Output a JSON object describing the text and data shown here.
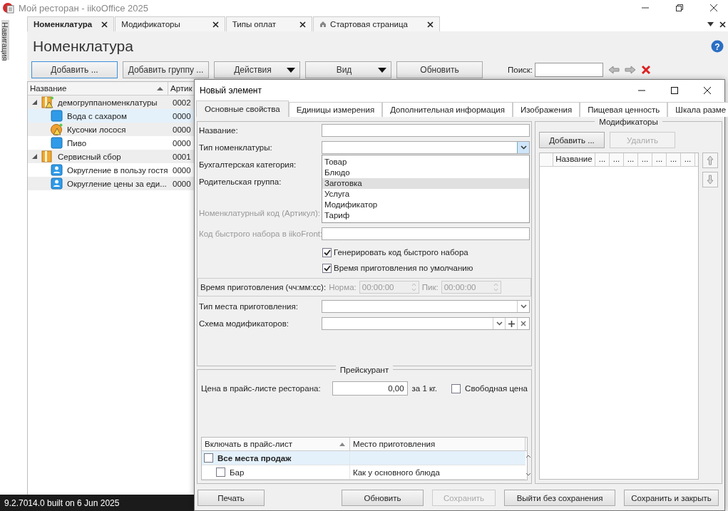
{
  "window": {
    "title": "Мой ресторан - iikoOffice 2025"
  },
  "nav_label": "Навигация",
  "tabs": [
    {
      "label": "Номенклатура",
      "selected": true,
      "home": false
    },
    {
      "label": "Модификаторы",
      "selected": false,
      "home": false
    },
    {
      "label": "Типы оплат",
      "selected": false,
      "home": false
    },
    {
      "label": "Стартовая страница",
      "selected": false,
      "home": true
    }
  ],
  "heading": "Номенклатура",
  "help": "?",
  "toolbar": [
    {
      "label": "Добавить ...",
      "kind": "plain",
      "focused": true
    },
    {
      "label": "Добавить группу ...",
      "kind": "plain",
      "focused": false
    },
    {
      "label": "Действия",
      "kind": "dropdown",
      "focused": false
    },
    {
      "label": "Вид",
      "kind": "dropdown",
      "focused": false
    },
    {
      "label": "Обновить",
      "kind": "plain",
      "focused": false
    }
  ],
  "search": {
    "label": "Поиск:"
  },
  "tree": {
    "columns": [
      "Название",
      "Артик"
    ],
    "rows": [
      {
        "name": "демогруппаноменклатуры",
        "code": "0002",
        "kind": "group-warning",
        "expanded": true,
        "selected": false,
        "children": [
          {
            "name": "Вода с сахаром",
            "code": "0000",
            "kind": "item",
            "selected": true
          },
          {
            "name": "Кусочки лосося",
            "code": "0000",
            "kind": "item-warning",
            "selected": false
          },
          {
            "name": "Пиво",
            "code": "0000",
            "kind": "item",
            "selected": false
          }
        ]
      },
      {
        "name": "Сервисный сбор",
        "code": "0001",
        "kind": "group",
        "expanded": true,
        "selected": false,
        "children": [
          {
            "name": "Округление в пользу гостя",
            "code": "0000",
            "kind": "service",
            "selected": false
          },
          {
            "name": "Округление цены за еди...",
            "code": "0000",
            "kind": "service",
            "selected": false
          }
        ]
      }
    ]
  },
  "status_bar": "9.2.7014.0 built on 6 Jun 2025",
  "dialog": {
    "title": "Новый элемент",
    "tabs": [
      {
        "label": "Основные свойства",
        "selected": true
      },
      {
        "label": "Единицы измерения",
        "selected": false
      },
      {
        "label": "Дополнительная информация",
        "selected": false
      },
      {
        "label": "Изображения",
        "selected": false
      },
      {
        "label": "Пищевая ценность",
        "selected": false
      },
      {
        "label": "Шкала разме",
        "selected": false
      }
    ],
    "fields": [
      {
        "label": "Название:",
        "kind": "text",
        "disabled": false
      },
      {
        "label": "Тип номенклатуры:",
        "kind": "combo",
        "disabled": false,
        "open": true
      },
      {
        "label": "Бухгалтерская категория:",
        "kind": "covered",
        "disabled": false
      },
      {
        "label": "Родительская группа:",
        "kind": "covered",
        "disabled": false
      },
      {
        "label": "Номенклатурный код (Артикул):",
        "kind": "covered",
        "disabled": true
      },
      {
        "label": "Код быстрого набора в iikoFront:",
        "kind": "text",
        "disabled": true
      }
    ],
    "dropdown": [
      {
        "label": "Товар",
        "selected": false
      },
      {
        "label": "Блюдо",
        "selected": false
      },
      {
        "label": "Заготовка",
        "selected": true
      },
      {
        "label": "Услуга",
        "selected": false
      },
      {
        "label": "Модификатор",
        "selected": false
      },
      {
        "label": "Тариф",
        "selected": false
      }
    ],
    "checkboxes": [
      {
        "label": "Генерировать код быстрого набора",
        "checked": true
      },
      {
        "label": "Время приготовления по умолчанию",
        "checked": true
      }
    ],
    "cook_time": {
      "label": "Время приготовления (чч:мм:сс):",
      "norm_label": "Норма:",
      "norm": "00:00:00",
      "peak_label": "Пик:",
      "peak": "00:00:00",
      "disabled": true
    },
    "fields2": [
      {
        "label": "Тип места приготовления:",
        "kind": "combo"
      },
      {
        "label": "Схема модификаторов:",
        "kind": "combo-actions"
      }
    ],
    "price": {
      "title": "Прейскурант",
      "label": "Цена в прайс-листе ресторана:",
      "value": "0,00",
      "unit": "за 1 кг.",
      "free_label": "Свободная цена",
      "free_checked": false,
      "columns": [
        "Включать в прайс-лист",
        "Место приготовления"
      ],
      "rows": [
        {
          "name": "Все места продаж",
          "place": "",
          "checked": false,
          "kind": "group"
        },
        {
          "name": "Бар",
          "place": "Как у основного блюда",
          "checked": false,
          "kind": "item"
        }
      ]
    },
    "modifiers": {
      "title": "Модификаторы",
      "add": "Добавить ...",
      "remove": "Удалить",
      "remove_disabled": true,
      "columns": [
        "Название",
        "...",
        "...",
        "...",
        "...",
        "...",
        "...",
        "..."
      ]
    },
    "buttons": [
      {
        "label": "Печать",
        "disabled": false
      },
      {
        "label": "Обновить",
        "disabled": false
      },
      {
        "label": "Сохранить",
        "disabled": true
      },
      {
        "label": "Выйти без сохранения",
        "disabled": false
      },
      {
        "label": "Сохранить и закрыть",
        "disabled": false
      }
    ]
  }
}
